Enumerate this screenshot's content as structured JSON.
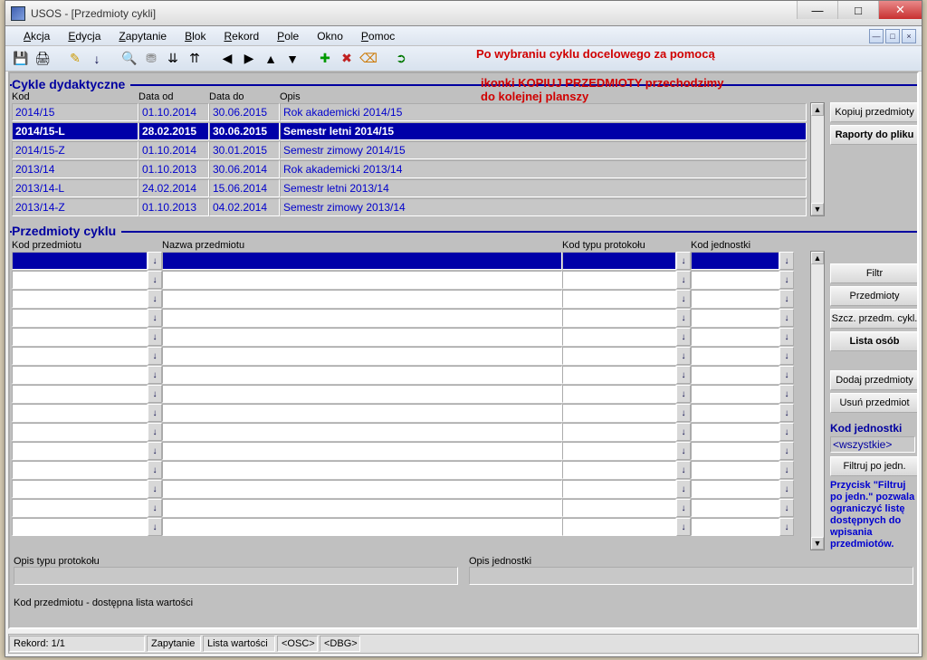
{
  "window": {
    "title": "USOS - [Przedmioty cykli]"
  },
  "menu": {
    "items": [
      "Akcja",
      "Edycja",
      "Zapytanie",
      "Blok",
      "Rekord",
      "Pole",
      "Okno",
      "Pomoc"
    ]
  },
  "overlay": {
    "line1": "Po wybraniu cyklu docelowego za pomocą",
    "line2": "ikonki KOPIUJ PRZEDMIOTY przechodzimy",
    "line3": "do kolejnej planszy"
  },
  "cycles": {
    "header": "Cykle dydaktyczne",
    "col_kod": "Kod",
    "col_data_od": "Data od",
    "col_data_do": "Data do",
    "col_opis": "Opis",
    "rows": [
      {
        "kod": "2014/15",
        "od": "01.10.2014",
        "do": "30.06.2015",
        "opis": "Rok akademicki 2014/15"
      },
      {
        "kod": "2014/15-L",
        "od": "28.02.2015",
        "do": "30.06.2015",
        "opis": "Semestr letni 2014/15"
      },
      {
        "kod": "2014/15-Z",
        "od": "01.10.2014",
        "do": "30.01.2015",
        "opis": "Semestr zimowy 2014/15"
      },
      {
        "kod": "2013/14",
        "od": "01.10.2013",
        "do": "30.06.2014",
        "opis": "Rok akademicki 2013/14"
      },
      {
        "kod": "2013/14-L",
        "od": "24.02.2014",
        "do": "15.06.2014",
        "opis": "Semestr letni 2013/14"
      },
      {
        "kod": "2013/14-Z",
        "od": "01.10.2013",
        "do": "04.02.2014",
        "opis": "Semestr zimowy 2013/14"
      }
    ],
    "selected_index": 1,
    "btn_copy": "Kopiuj przedmioty",
    "btn_reports": "Raporty do pliku"
  },
  "subjects": {
    "header": "Przedmioty cyklu",
    "col_kod": "Kod przedmiotu",
    "col_nazwa": "Nazwa przedmiotu",
    "col_prot": "Kod typu protokołu",
    "col_jedn": "Kod jednostki",
    "row_count": 15,
    "selected_index": 0,
    "btn_filter": "Filtr",
    "btn_subjects": "Przedmioty",
    "btn_details": "Szcz. przedm. cykl.",
    "btn_people": "Lista osób",
    "btn_add": "Dodaj przedmioty",
    "btn_delete": "Usuń przedmiot",
    "unit_label": "Kod jednostki",
    "unit_value": "<wszystkie>",
    "btn_filter_unit": "Filtruj po jedn.",
    "note": "Przycisk \"Filtruj po jedn.\" pozwala ograniczyć listę dostępnych do wpisania przedmiotów."
  },
  "bottom": {
    "opis_prot_label": "Opis typu protokołu",
    "opis_jedn_label": "Opis jednostki",
    "hint": "Kod przedmiotu - dostępna lista wartości"
  },
  "status": {
    "rekord": "Rekord: 1/1",
    "zapytanie": "Zapytanie",
    "lista": "Lista wartości",
    "osc": "<OSC>",
    "dbg": "<DBG>"
  }
}
